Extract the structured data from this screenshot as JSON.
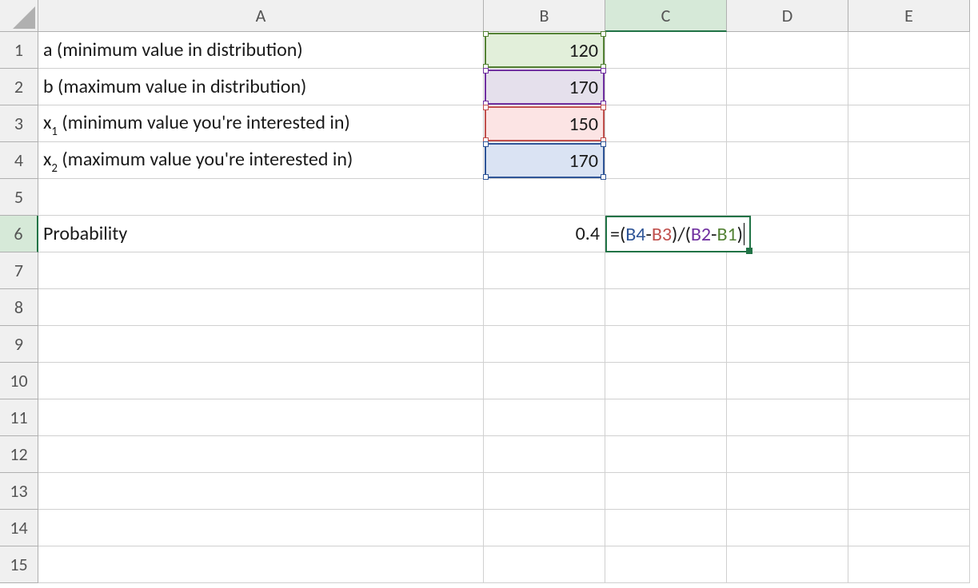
{
  "columns": [
    "A",
    "B",
    "C",
    "D",
    "E"
  ],
  "row_count": 15,
  "rows": {
    "1": {
      "A": {
        "text": "a (minimum value in distribution)"
      },
      "B": {
        "text": "120",
        "ref_color": "green"
      }
    },
    "2": {
      "A": {
        "text": "b (maximum value in distribution)"
      },
      "B": {
        "text": "170",
        "ref_color": "purple"
      }
    },
    "3": {
      "A": {
        "html": "x<span class=\"sub\">1</span> (minimum value you're interested in)"
      },
      "B": {
        "text": "150",
        "ref_color": "red"
      }
    },
    "4": {
      "A": {
        "html": "x<span class=\"sub\">2</span> (maximum value you're interested in)"
      },
      "B": {
        "text": "170",
        "ref_color": "blue"
      }
    },
    "6": {
      "A": {
        "text": "Probability"
      },
      "B": {
        "text": "0.4"
      }
    }
  },
  "active_cell": {
    "col": "C",
    "row": 6
  },
  "formula_edit": {
    "cell": "C6",
    "plain": "=(B4-B3)/(B2-B1)",
    "tokens": [
      {
        "t": "=",
        "c": "op"
      },
      {
        "t": "(",
        "c": "op"
      },
      {
        "t": "B4",
        "c": "blue"
      },
      {
        "t": "-",
        "c": "op"
      },
      {
        "t": "B3",
        "c": "red"
      },
      {
        "t": ")",
        "c": "op"
      },
      {
        "t": "/",
        "c": "op"
      },
      {
        "t": "(",
        "c": "op"
      },
      {
        "t": "B2",
        "c": "purple"
      },
      {
        "t": "-",
        "c": "op"
      },
      {
        "t": "B1",
        "c": "green"
      },
      {
        "t": ")",
        "c": "op"
      }
    ]
  }
}
